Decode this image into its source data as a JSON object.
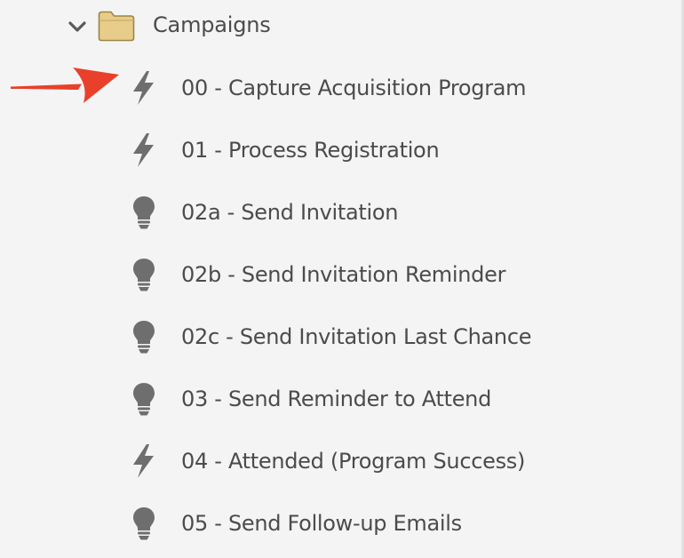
{
  "colors": {
    "background": "#f4f4f4",
    "text": "#4b4b4b",
    "icon": "#6e6e6e",
    "folder_fill": "#e8cd8a",
    "folder_stroke": "#9c8348",
    "annotation_arrow": "#e8402a"
  },
  "tree": {
    "folder": {
      "label": "Campaigns",
      "expand_icon": "chevron-down-icon",
      "icon": "folder-icon",
      "expanded": true
    },
    "items": [
      {
        "label": "00 - Capture Acquisition Program",
        "icon": "lightning-bolt-icon",
        "type": "trigger"
      },
      {
        "label": "01 - Process Registration",
        "icon": "lightning-bolt-icon",
        "type": "trigger"
      },
      {
        "label": "02a - Send Invitation",
        "icon": "lightbulb-icon",
        "type": "batch"
      },
      {
        "label": "02b - Send Invitation Reminder",
        "icon": "lightbulb-icon",
        "type": "batch"
      },
      {
        "label": "02c - Send Invitation Last Chance",
        "icon": "lightbulb-icon",
        "type": "batch"
      },
      {
        "label": "03 - Send Reminder to Attend",
        "icon": "lightbulb-icon",
        "type": "batch"
      },
      {
        "label": "04 - Attended (Program Success)",
        "icon": "lightning-bolt-icon",
        "type": "trigger"
      },
      {
        "label": "05 - Send Follow-up Emails",
        "icon": "lightbulb-icon",
        "type": "batch"
      }
    ]
  },
  "annotation": {
    "icon": "red-arrow-icon",
    "points_to_item": 0
  }
}
